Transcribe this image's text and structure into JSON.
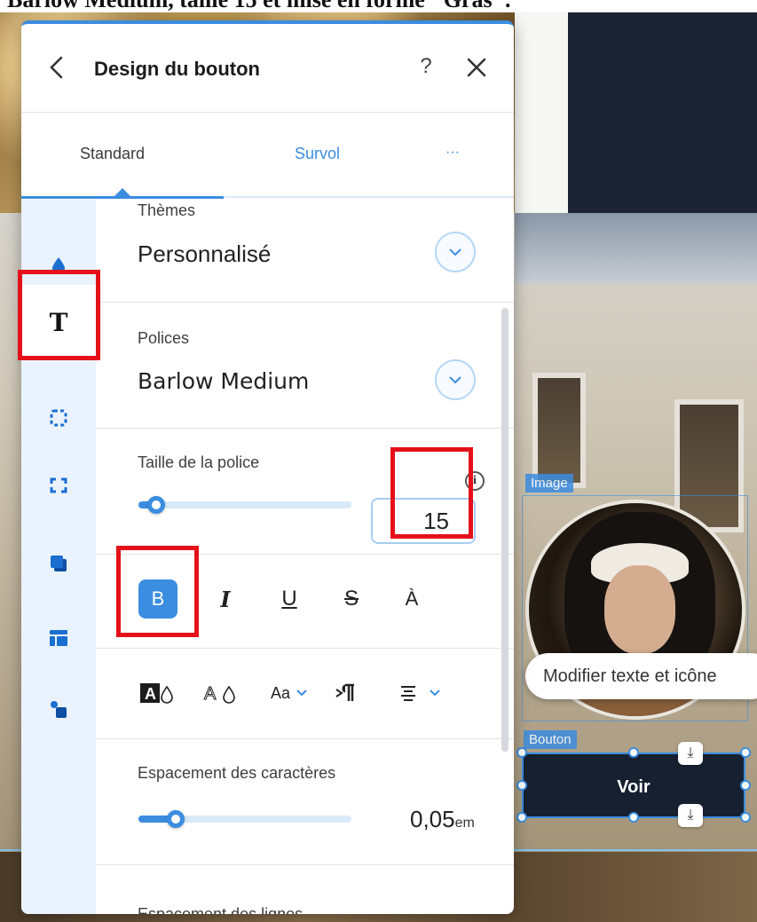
{
  "caption": "Barlow Medium, taille 15 et mise en forme \"Gras\".",
  "panel": {
    "title": "Design du bouton",
    "help_glyph": "?",
    "tabs": [
      "Standard",
      "Survol",
      "···"
    ]
  },
  "sidebar": {
    "icons": [
      "fill-drop-icon",
      "text-T-icon",
      "border-icon",
      "corners-icon",
      "shadow-icon",
      "layout-icon",
      "icon-settings-icon"
    ],
    "active": "text-T-icon",
    "text_icon_glyph": "T"
  },
  "sections": {
    "themes": {
      "label": "Thèmes",
      "value": "Personnalisé"
    },
    "fonts": {
      "label": "Polices",
      "value": "Barlow Medium"
    },
    "font_size": {
      "label": "Taille de la police",
      "value": "15",
      "info_glyph": "i",
      "slider_fraction": 0.05
    },
    "format_buttons": [
      "B",
      "I",
      "U",
      "S",
      "À"
    ],
    "format_active": "B",
    "advanced_row": [
      "text-highlight-icon",
      "text-outline-icon",
      "Aa",
      "paragraph-direction-icon",
      "align-icon"
    ],
    "letter_spacing": {
      "label": "Espacement des caractères",
      "value": "0,05",
      "unit": "em",
      "slider_fraction": 0.15
    },
    "line_spacing": {
      "label": "Espacement des lignes"
    }
  },
  "canvas": {
    "image_label": "Image",
    "button_label": "Bouton",
    "button_text": "Voir",
    "tooltip": "Modifier texte et icône"
  },
  "colors": {
    "accent": "#3b8de0",
    "highlight_box": "#e4111a",
    "rail_bg": "#eaf3fd",
    "button_bg": "#172031"
  }
}
